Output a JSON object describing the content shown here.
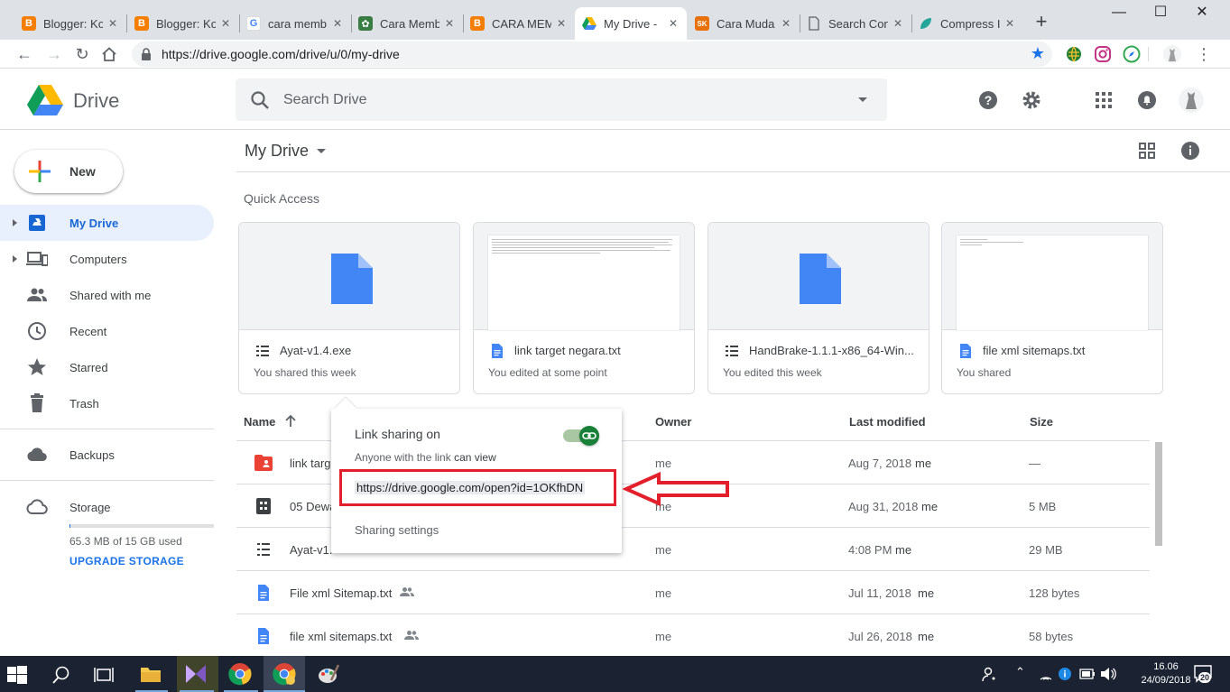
{
  "browser": {
    "tabs": [
      {
        "title": "Blogger: Ko",
        "favicon": "blogger-icon",
        "color": "#f57d00",
        "active": false
      },
      {
        "title": "Blogger: Ko",
        "favicon": "blogger-icon",
        "color": "#f57d00",
        "active": false
      },
      {
        "title": "cara memb",
        "favicon": "google-icon",
        "color": "#4285f4",
        "active": false
      },
      {
        "title": "Cara Memb",
        "favicon": "site-icon",
        "color": "#3a7d44",
        "active": false
      },
      {
        "title": "CARA MEM",
        "favicon": "blogger-icon",
        "color": "#f57d00",
        "active": false
      },
      {
        "title": "My Drive -",
        "favicon": "drive-icon",
        "color": "#1fa463",
        "active": true
      },
      {
        "title": "Cara Muda",
        "favicon": "sk-icon",
        "color": "#e8710a",
        "active": false
      },
      {
        "title": "Search Con",
        "favicon": "page-icon",
        "color": "#5f6368",
        "active": false
      },
      {
        "title": "Compress I",
        "favicon": "leaf-icon",
        "color": "#26a69a",
        "active": false
      }
    ],
    "url": "https://drive.google.com/drive/u/0/my-drive"
  },
  "drive": {
    "logo_text": "Drive",
    "search_placeholder": "Search Drive",
    "new_label": "New",
    "nav": [
      {
        "label": "My Drive",
        "icon": "my-drive-icon",
        "selected": true
      },
      {
        "label": "Computers",
        "icon": "computers-icon",
        "selected": false
      },
      {
        "label": "Shared with me",
        "icon": "shared-icon",
        "selected": false
      },
      {
        "label": "Recent",
        "icon": "clock-icon",
        "selected": false
      },
      {
        "label": "Starred",
        "icon": "star-icon",
        "selected": false
      },
      {
        "label": "Trash",
        "icon": "trash-icon",
        "selected": false
      },
      {
        "label": "Backups",
        "icon": "cloud-icon",
        "selected": false
      },
      {
        "label": "Storage",
        "icon": "cloud-outline-icon",
        "selected": false
      }
    ],
    "storage": {
      "used_text": "65.3 MB of 15 GB used",
      "used_fraction": 0.005,
      "upgrade": "UPGRADE STORAGE"
    },
    "breadcrumb": "My Drive",
    "quick_access_title": "Quick Access",
    "quick_access": [
      {
        "name": "Ayat-v1.4.exe",
        "sub": "You shared this week",
        "type": "binary-file-icon"
      },
      {
        "name": "link target negara.txt",
        "sub": "You edited at some point",
        "type": "doc-file-icon"
      },
      {
        "name": "HandBrake-1.1.1-x86_64-Win...",
        "sub": "You edited this week",
        "type": "binary-file-icon"
      },
      {
        "name": "file xml sitemaps.txt",
        "sub": "You shared",
        "type": "doc-file-icon"
      }
    ],
    "columns": {
      "name": "Name",
      "owner": "Owner",
      "last_modified": "Last modified",
      "size": "Size"
    },
    "files": [
      {
        "name": "link targ",
        "owner": "me",
        "modified": "Aug 7, 2018",
        "modified_by": "me",
        "size": "—",
        "icon": "folder-shared-icon",
        "shared": false
      },
      {
        "name": "05 Dewa",
        "owner": "me",
        "modified": "Aug 31, 2018",
        "modified_by": "me",
        "size": "5 MB",
        "icon": "archive-file-icon",
        "shared": false
      },
      {
        "name": "Ayat-v1.",
        "owner": "me",
        "modified": "4:08 PM",
        "modified_by": "me",
        "size": "29 MB",
        "icon": "binary-file-icon",
        "shared": false
      },
      {
        "name": "File xml Sitemap.txt",
        "owner": "me",
        "modified": "Jul 11, 2018",
        "modified_by": "me",
        "size": "128 bytes",
        "icon": "doc-file-icon",
        "shared": true
      },
      {
        "name": "file xml sitemaps.txt",
        "owner": "me",
        "modified": "Jul 26, 2018",
        "modified_by": "me",
        "size": "58 bytes",
        "icon": "doc-file-icon",
        "shared": true
      }
    ],
    "link_popover": {
      "title": "Link sharing on",
      "subtitle_prefix": "Anyone with the link",
      "subtitle_strong": "can view",
      "link": "https://drive.google.com/open?id=1OKfhDN",
      "settings": "Sharing settings",
      "toggle_on": true
    }
  },
  "taskbar": {
    "time": "16.06",
    "date": "24/09/2018",
    "notifications": "20"
  },
  "colors": {
    "accent": "#1a73e8",
    "highlight_red": "#e21f2a",
    "toggle_green": "#188038"
  }
}
